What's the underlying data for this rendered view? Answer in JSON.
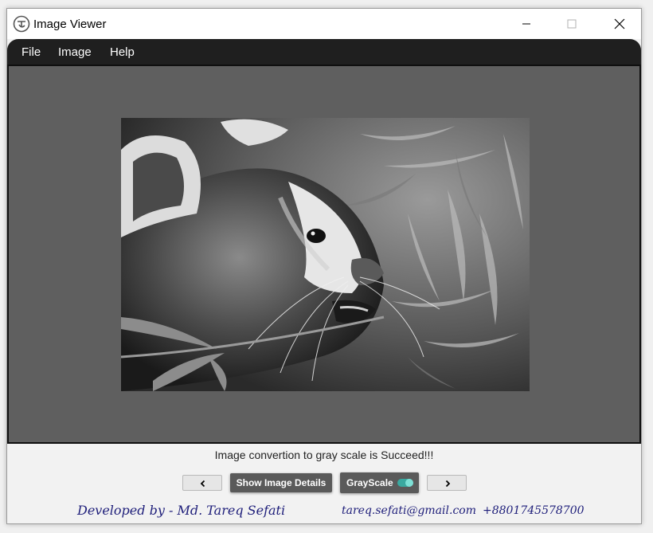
{
  "window": {
    "title": "Image Viewer"
  },
  "menu": {
    "items": [
      "File",
      "Image",
      "Help"
    ]
  },
  "image": {
    "description_icon": "red-panda-grayscale-photo"
  },
  "status": {
    "message": "Image convertion to gray scale is Succeed!!!"
  },
  "controls": {
    "prev_icon": "chevron-left-icon",
    "details_label": "Show Image Details",
    "grayscale_label": "GrayScale",
    "grayscale_on": true,
    "next_icon": "chevron-right-icon"
  },
  "footer": {
    "developer": "Developed by - Md. Tareq Sefati",
    "email": "tareq.sefati@gmail.com",
    "phone": "+8801745578700"
  },
  "colors": {
    "menubar": "#1f1f1f",
    "viewer_bg": "#5f5f5f",
    "button_dark": "#5a5a5a",
    "toggle_accent": "#3aa9a0",
    "footer_text": "#1e1e7a"
  }
}
